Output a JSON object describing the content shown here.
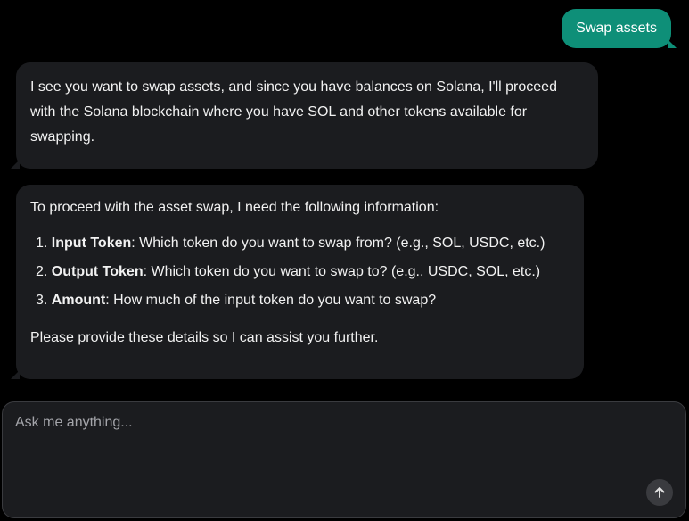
{
  "messages": {
    "user": {
      "text": "Swap assets"
    },
    "assistant1": {
      "text": "I see you want to swap assets, and since you have balances on Solana, I'll proceed with the Solana blockchain where you have SOL and other tokens available for swapping."
    },
    "assistant2": {
      "intro": "To proceed with the asset swap, I need the following information:",
      "items": [
        {
          "num": "1.",
          "label": "Input Token",
          "text": ": Which token do you want to swap from? (e.g., SOL, USDC, etc.)"
        },
        {
          "num": "2.",
          "label": "Output Token",
          "text": ": Which token do you want to swap to? (e.g., USDC, SOL, etc.)"
        },
        {
          "num": "3.",
          "label": "Amount",
          "text": ": How much of the input token do you want to swap?"
        }
      ],
      "outro": "Please provide these details so I can assist you further."
    }
  },
  "composer": {
    "placeholder": "Ask me anything...",
    "value": "",
    "send_icon": "arrow-up-icon"
  },
  "colors": {
    "background": "#000000",
    "user_bubble": "#0e8f78",
    "assistant_bubble": "#1b1c1f",
    "text": "#f2f2f2"
  }
}
